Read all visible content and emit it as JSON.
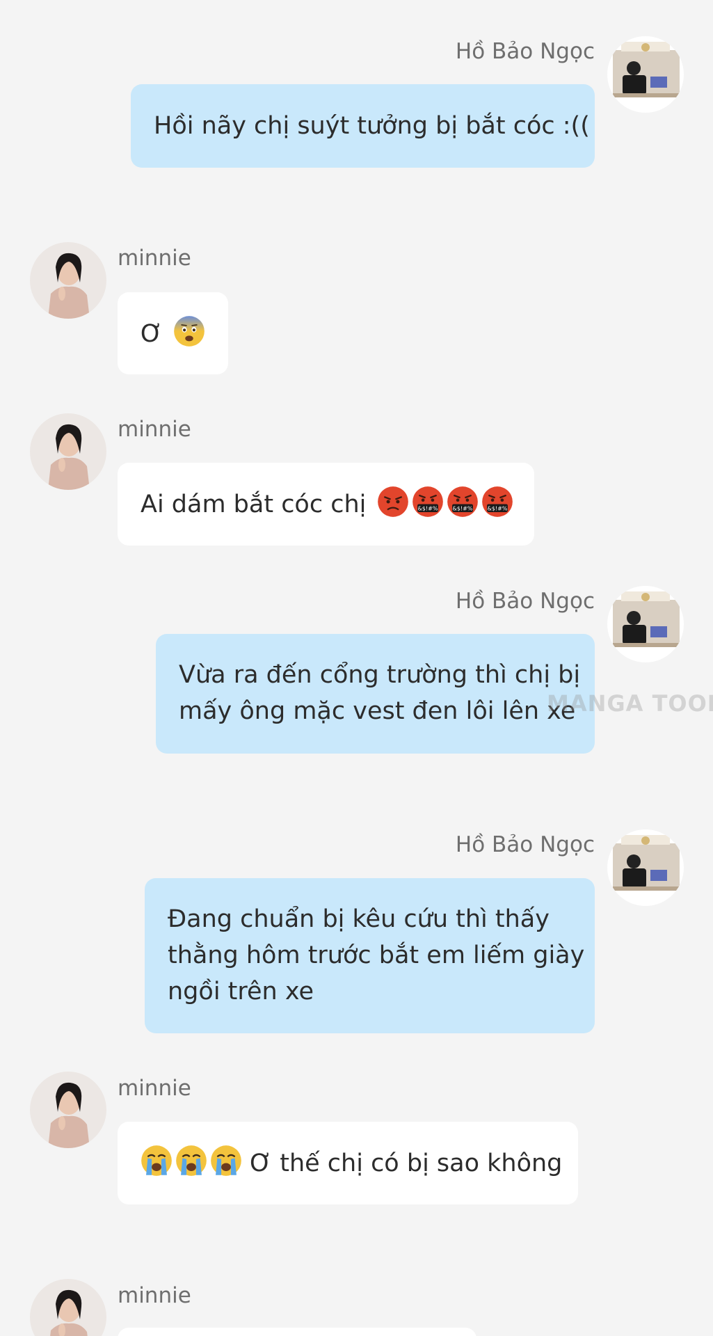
{
  "messages": [
    {
      "sender": "Hồ Bảo Ngọc",
      "text": "Hồi nãy chị suýt tưởng bị bắt cóc :(("
    },
    {
      "sender": "minnie",
      "text": "Ơ"
    },
    {
      "sender": "minnie",
      "text": "Ai dám bắt cóc chị"
    },
    {
      "sender": "Hồ Bảo Ngọc",
      "lines": [
        "Vừa ra đến cổng trường thì chị bị",
        "mấy ông mặc vest đen lôi lên xe"
      ]
    },
    {
      "sender": "Hồ Bảo Ngọc",
      "lines": [
        "Đang chuẩn bị kêu cứu thì thấy",
        "thằng hôm trước bắt em liếm giày",
        "ngồi trên xe"
      ]
    },
    {
      "sender": "minnie",
      "text": "Ơ thế chị có bị sao không"
    },
    {
      "sender": "minnie"
    }
  ],
  "emojis": {
    "fearful": "fearful-face",
    "angry": "angry-face",
    "cursing": "face-with-symbols-on-mouth",
    "crying": "loudly-crying-face"
  },
  "watermark": "MANGA TOON",
  "colors": {
    "background": "#f4f4f4",
    "my_bubble": "#c9e8fb",
    "their_bubble": "#ffffff",
    "name_text": "#6e6e6e"
  }
}
